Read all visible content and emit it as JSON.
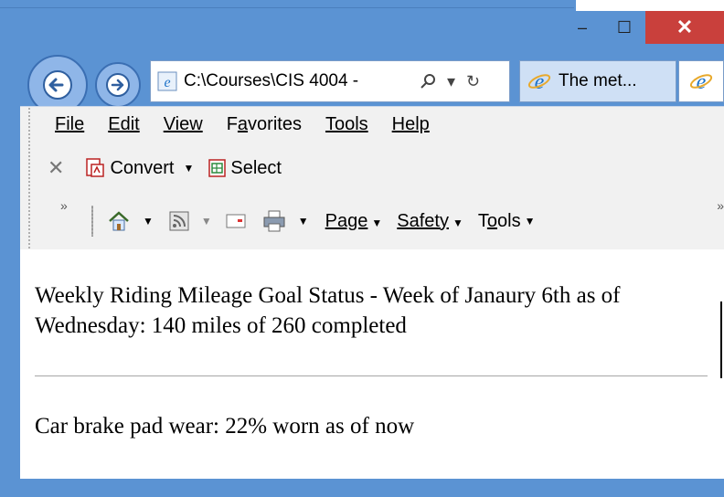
{
  "window": {
    "minimize_glyph": "–",
    "maximize_glyph": "☐",
    "close_glyph": "✕",
    "accent": "#5b93d3",
    "close_color": "#c9403c"
  },
  "nav": {
    "back_icon": "back-arrow-icon",
    "forward_icon": "forward-arrow-icon",
    "address": "C:\\Courses\\CIS 4004 -",
    "address_tools": [
      "search",
      "dropdown",
      "refresh"
    ],
    "active_tab": "The met...",
    "second_tab_icon": "ie-icon"
  },
  "menu": {
    "items": [
      "File",
      "Edit",
      "View",
      "Favorites",
      "Tools",
      "Help"
    ],
    "underline_index": [
      0,
      0,
      0,
      1,
      0,
      0
    ]
  },
  "commandbar": {
    "convert": "Convert",
    "select": "Select",
    "page": "Page",
    "safety": "Safety",
    "tools": "Tools"
  },
  "content": {
    "status_text": "Weekly Riding Mileage Goal Status - Week of Janaury 6th as of Wednesday: 140 miles of 260 completed",
    "brake_text": "Car brake pad wear: 22% worn as of now"
  }
}
